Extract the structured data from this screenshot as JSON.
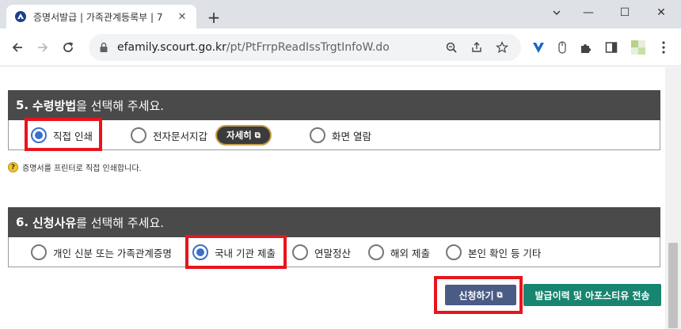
{
  "browser": {
    "tab_title": "증명서발급 | 가족관계등록부 | 7",
    "tab_close": "✕",
    "new_tab": "+",
    "minimize": "—",
    "maximize": "☐",
    "close": "✕",
    "url_host": "efamily.scourt.go.kr",
    "url_path": "/pt/PtFrrpReadIssTrgtInfoW.do"
  },
  "section5": {
    "num": "5.",
    "title_strong": "수령방법",
    "title_rest": "을 선택해 주세요.",
    "options": [
      {
        "label": "직접 인쇄",
        "checked": true
      },
      {
        "label": "전자문서지갑",
        "checked": false
      },
      {
        "label": "화면 열람",
        "checked": false
      }
    ],
    "detail_button": "자세히",
    "hint": "증명서를 프린터로 직접 인쇄합니다."
  },
  "section6": {
    "num": "6.",
    "title_strong": "신청사유",
    "title_rest": "를 선택해 주세요.",
    "options": [
      {
        "label": "개인 신분 또는 가족관계증명",
        "checked": false
      },
      {
        "label": "국내 기관 제출",
        "checked": true
      },
      {
        "label": "연말정산",
        "checked": false
      },
      {
        "label": "해외 제출",
        "checked": false
      },
      {
        "label": "본인 확인 등 기타",
        "checked": false
      }
    ]
  },
  "buttons": {
    "apply": "신청하기",
    "history": "발급이력 및 아포스티유 전송"
  },
  "icons": {
    "hint": "?",
    "external": "⧉"
  },
  "colors": {
    "header_bg": "#4a4a4a",
    "highlight": "#e8141e",
    "radio_checked": "#3a6fc9",
    "apply_bg": "#4a5b86",
    "history_bg": "#17856f"
  }
}
